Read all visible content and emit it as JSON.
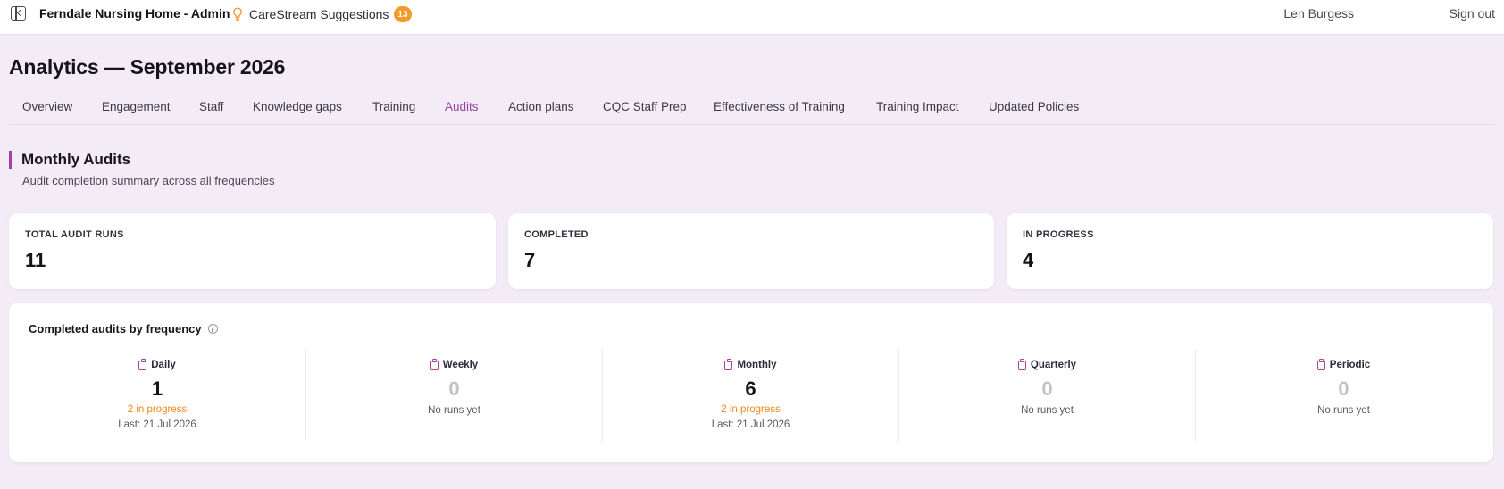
{
  "header": {
    "app_title": "Ferndale Nursing Home - Admin",
    "suggestions_label": "CareStream Suggestions",
    "suggestions_count": "13",
    "user_name": "Len Burgess",
    "sign_out": "Sign out"
  },
  "page_title": "Analytics — September 2026",
  "tabs": [
    {
      "label": "Overview"
    },
    {
      "label": "Engagement"
    },
    {
      "label": "Staff"
    },
    {
      "label": "Knowledge gaps"
    },
    {
      "label": "Training"
    },
    {
      "label": "Audits"
    },
    {
      "label": "Action plans"
    },
    {
      "label": "CQC Staff Prep"
    },
    {
      "label": "Effectiveness of Training"
    },
    {
      "label": "Training Impact"
    },
    {
      "label": "Updated Policies"
    }
  ],
  "active_tab": "Audits",
  "section": {
    "title": "Monthly Audits",
    "subtitle": "Audit completion summary across all frequencies"
  },
  "kpis": [
    {
      "label": "TOTAL AUDIT RUNS",
      "value": "11"
    },
    {
      "label": "COMPLETED",
      "value": "7"
    },
    {
      "label": "IN PROGRESS",
      "value": "4"
    }
  ],
  "frequency_panel": {
    "title": "Completed audits by frequency",
    "columns": [
      {
        "name": "Daily",
        "count": "1",
        "in_progress": "2 in progress",
        "last": "Last: 21 Jul 2026"
      },
      {
        "name": "Weekly",
        "count": "0",
        "no_runs": "No runs yet"
      },
      {
        "name": "Monthly",
        "count": "6",
        "in_progress": "2 in progress",
        "last": "Last: 21 Jul 2026"
      },
      {
        "name": "Quarterly",
        "count": "0",
        "no_runs": "No runs yet"
      },
      {
        "name": "Periodic",
        "count": "0",
        "no_runs": "No runs yet"
      }
    ]
  },
  "colors": {
    "accent": "#9b3fa3",
    "badge": "#f39a2a",
    "in_progress": "#ef8a1e",
    "background": "#f3ecf7"
  }
}
